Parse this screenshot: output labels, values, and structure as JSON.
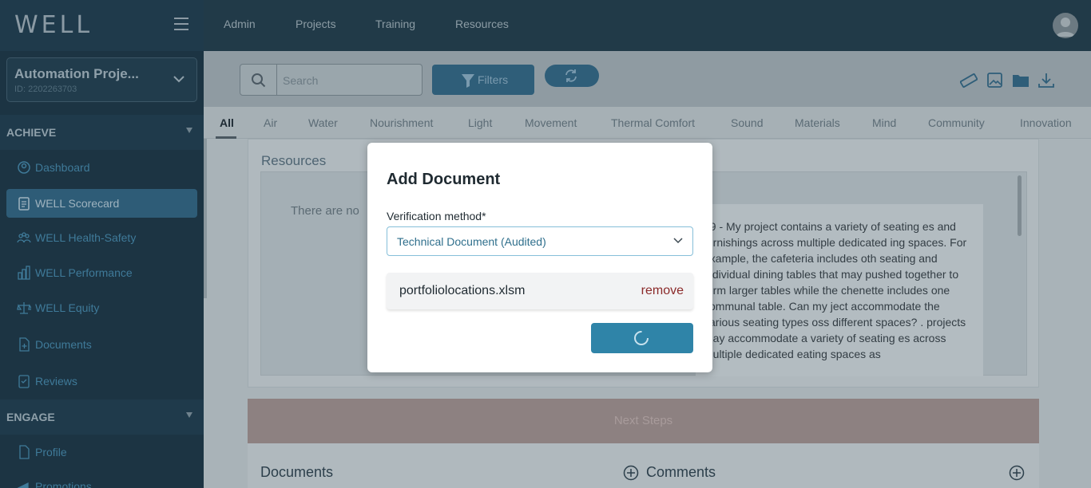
{
  "sidebar": {
    "logo": "WELL",
    "project": {
      "name": "Automation Proje...",
      "id": "ID: 2202263703"
    },
    "achieve": {
      "header": "ACHIEVE",
      "items": [
        {
          "label": "Dashboard",
          "icon": "dashboard-icon"
        },
        {
          "label": "WELL Scorecard",
          "icon": "scorecard-icon",
          "active": true
        },
        {
          "label": "WELL Health-Safety",
          "icon": "health-safety-icon"
        },
        {
          "label": "WELL Performance",
          "icon": "performance-icon"
        },
        {
          "label": "WELL Equity",
          "icon": "equity-icon"
        },
        {
          "label": "Documents",
          "icon": "documents-icon"
        },
        {
          "label": "Reviews",
          "icon": "reviews-icon"
        }
      ]
    },
    "engage": {
      "header": "ENGAGE",
      "items": [
        {
          "label": "Profile",
          "icon": "profile-icon"
        },
        {
          "label": "Promotions",
          "icon": "promotions-icon"
        }
      ]
    }
  },
  "topnav": {
    "items": [
      "Admin",
      "Projects",
      "Training",
      "Resources"
    ]
  },
  "toolbar": {
    "search_placeholder": "Search",
    "filters_label": "Filters"
  },
  "tabs": [
    "All",
    "Air",
    "Water",
    "Nourishment",
    "Light",
    "Movement",
    "Thermal Comfort",
    "Sound",
    "Materials",
    "Mind",
    "Community",
    "Innovation"
  ],
  "resources": {
    "title": "Resources",
    "empty_text": "There are no",
    "faq_text": "09 - My project contains a variety of seating es and furnishings across multiple dedicated ing spaces. For example, the cafeteria includes oth seating and individual dining tables that may pushed together to form larger tables while the chenette includes one communal table. Can my ject accommodate the various seating types oss different spaces? . projects may accommodate a variety of seating es across multiple dedicated eating spaces as"
  },
  "next_steps": {
    "label": "Next Steps"
  },
  "bottom": {
    "documents_title": "Documents",
    "comments_title": "Comments"
  },
  "modal": {
    "title": "Add Document",
    "verification_label": "Verification method*",
    "verification_value": "Technical Document (Audited)",
    "file_name": "portfoliolocations.xlsm",
    "remove_label": "remove"
  },
  "colors": {
    "accent": "#2f84a8",
    "sidebar": "#1c3443",
    "remove": "#8b2a2a"
  }
}
